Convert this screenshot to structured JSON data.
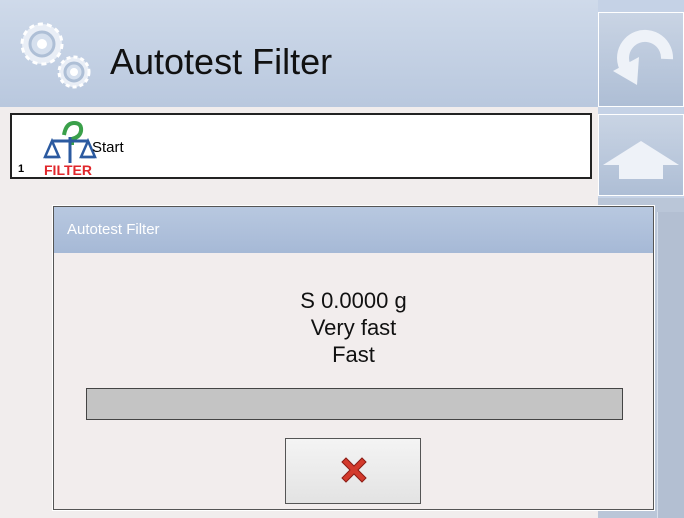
{
  "header": {
    "title": "Autotest Filter",
    "icon": "gears-icon"
  },
  "side_buttons": [
    {
      "name": "undo-button",
      "icon": "undo-icon"
    },
    {
      "name": "home-button",
      "icon": "home-icon"
    }
  ],
  "list": {
    "items": [
      {
        "number": "1",
        "label": "Start",
        "icon": "filter-scale-icon",
        "icon_text": "FILTER"
      }
    ]
  },
  "dialog": {
    "title": "Autotest Filter",
    "lines": [
      "S 0.0000 g",
      "Very fast",
      "Fast"
    ],
    "progress": 0,
    "cancel_icon": "close-icon"
  },
  "colors": {
    "header_bg": "#c5d2e6",
    "content_bg": "#f1eded",
    "cancel_red": "#d33a2c",
    "filter_red": "#e0262b"
  }
}
